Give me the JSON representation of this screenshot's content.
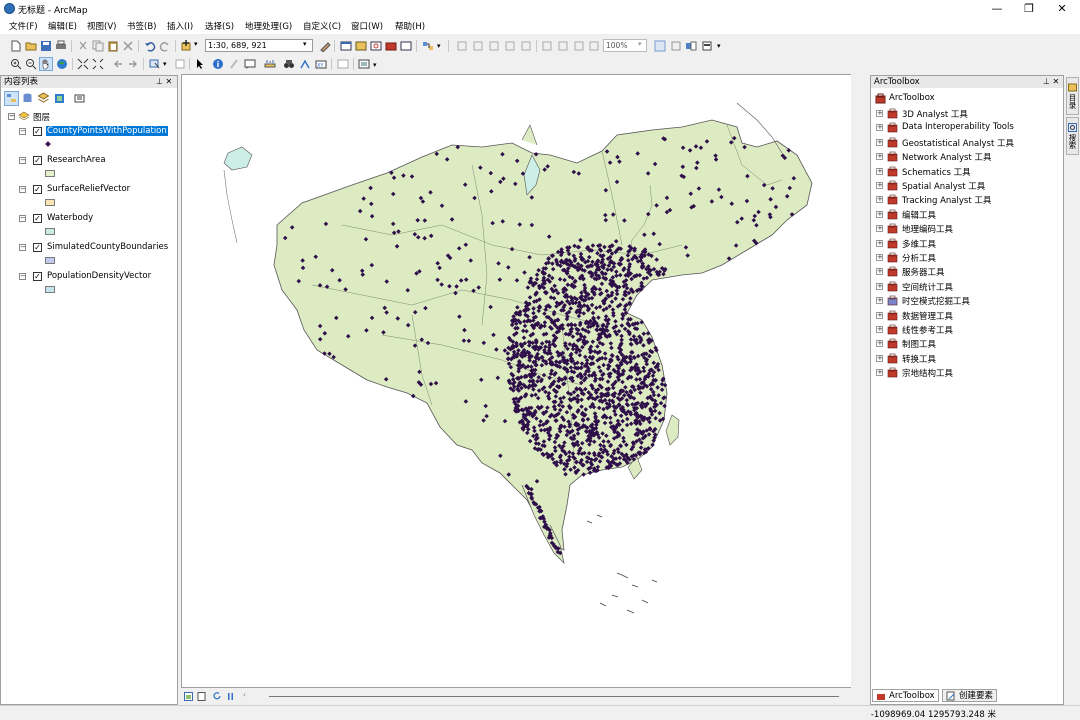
{
  "window": {
    "title": "无标题 - ArcMap",
    "controls": [
      "—",
      "❐",
      "✕"
    ]
  },
  "menu": [
    "文件(F)",
    "编辑(E)",
    "视图(V)",
    "书签(B)",
    "插入(I)",
    "选择(S)",
    "地理处理(G)",
    "自定义(C)",
    "窗口(W)",
    "帮助(H)"
  ],
  "toolbar": {
    "scale_value": "1:30, 689, 921",
    "zoom_value": "100%"
  },
  "toc": {
    "title": "内容列表",
    "panel_controls": "⊥ ✕",
    "root_label": "图层",
    "layers": [
      {
        "name": "CountyPointsWithPopulation",
        "checked": true,
        "selected": true,
        "symbol": "point",
        "color": "#3b1253"
      },
      {
        "name": "ResearchArea",
        "checked": true,
        "selected": false,
        "symbol": "fill",
        "color": "#e3f0c9"
      },
      {
        "name": "SurfaceReliefVector",
        "checked": true,
        "selected": false,
        "symbol": "fill",
        "color": "#fae6b3"
      },
      {
        "name": "Waterbody",
        "checked": true,
        "selected": false,
        "symbol": "fill",
        "color": "#c9ecdc"
      },
      {
        "name": "SimulatedCountyBoundaries",
        "checked": true,
        "selected": false,
        "symbol": "fill",
        "color": "#c3c8ef"
      },
      {
        "name": "PopulationDensityVector",
        "checked": true,
        "selected": false,
        "symbol": "fill",
        "color": "#c4e6ea"
      }
    ]
  },
  "map": {
    "land_color": "#ddebc3",
    "point_color": "#2e0f4a",
    "water_color": "#cdeee6"
  },
  "toolbox": {
    "title": "ArcToolbox",
    "panel_controls": "⊥ ✕",
    "root_label": "ArcToolbox",
    "items": [
      "3D Analyst 工具",
      "Data Interoperability Tools",
      "Geostatistical Analyst 工具",
      "Network Analyst 工具",
      "Schematics 工具",
      "Spatial Analyst 工具",
      "Tracking Analyst 工具",
      "编辑工具",
      "地理编码工具",
      "多维工具",
      "分析工具",
      "服务器工具",
      "空间统计工具",
      "时空模式挖掘工具",
      "数据管理工具",
      "线性参考工具",
      "制图工具",
      "转换工具",
      "宗地结构工具"
    ],
    "tabs": [
      "ArcToolbox",
      "创建要素"
    ],
    "side_tabs": [
      "目录",
      "搜索"
    ]
  },
  "status": {
    "coordinates": "-1098969.04  1295793.248 米"
  }
}
